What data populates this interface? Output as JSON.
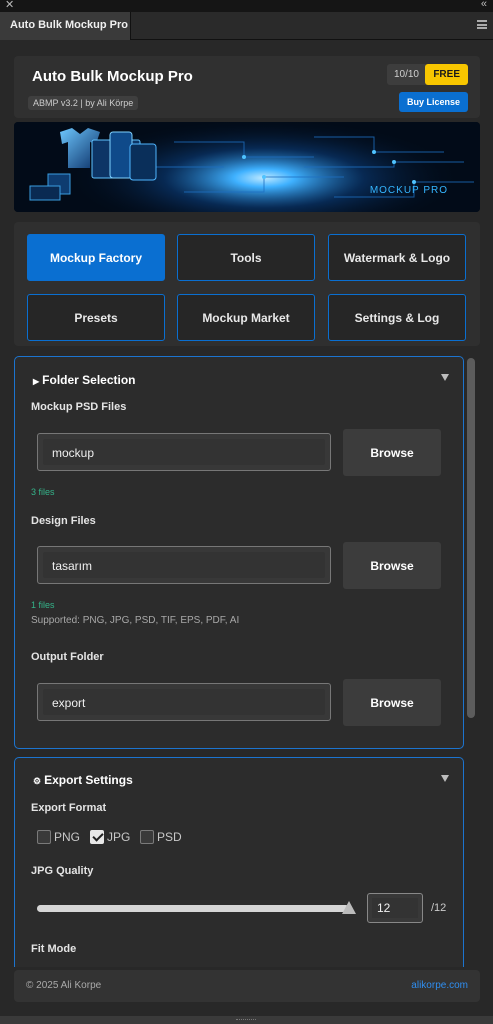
{
  "window": {
    "close_glyph": "✕",
    "collapse_glyph": "«",
    "tab_label": "Auto Bulk Mockup Pro"
  },
  "header": {
    "title": "Auto Bulk Mockup Pro",
    "version": "ABMP v3.2 | by Ali Körpe",
    "usage_count": "10/10",
    "plan_badge": "FREE",
    "buy_label": "Buy License"
  },
  "banner": {
    "brand_text": "MOCKUP PRO"
  },
  "nav": {
    "buttons": [
      {
        "label": "Mockup Factory",
        "active": true
      },
      {
        "label": "Tools",
        "active": false
      },
      {
        "label": "Watermark & Logo",
        "active": false
      },
      {
        "label": "Presets",
        "active": false
      },
      {
        "label": "Mockup Market",
        "active": false
      },
      {
        "label": "Settings & Log",
        "active": false
      }
    ]
  },
  "folder_selection": {
    "title": "Folder Selection",
    "mockup": {
      "label": "Mockup PSD Files",
      "value": "mockup",
      "count": "3 files",
      "browse": "Browse"
    },
    "design": {
      "label": "Design Files",
      "value": "tasarım",
      "count": "1 files",
      "supported": "Supported: PNG, JPG, PSD, TIF, EPS, PDF, AI",
      "browse": "Browse"
    },
    "output": {
      "label": "Output Folder",
      "value": "export",
      "browse": "Browse"
    }
  },
  "export_settings": {
    "title": "Export Settings",
    "format_label": "Export Format",
    "formats": [
      {
        "label": "PNG",
        "checked": false
      },
      {
        "label": "JPG",
        "checked": true
      },
      {
        "label": "PSD",
        "checked": false
      }
    ],
    "quality_label": "JPG Quality",
    "quality_value": "12",
    "quality_max": "/12",
    "quality_fraction": 1.0,
    "fit_mode_label": "Fit Mode"
  },
  "footer": {
    "copyright": "© 2025 Ali Korpe",
    "site": "alikorpe.com"
  },
  "colors": {
    "accent": "#0a6fd1",
    "badge": "#f7c600",
    "count_green": "#34b48a"
  }
}
